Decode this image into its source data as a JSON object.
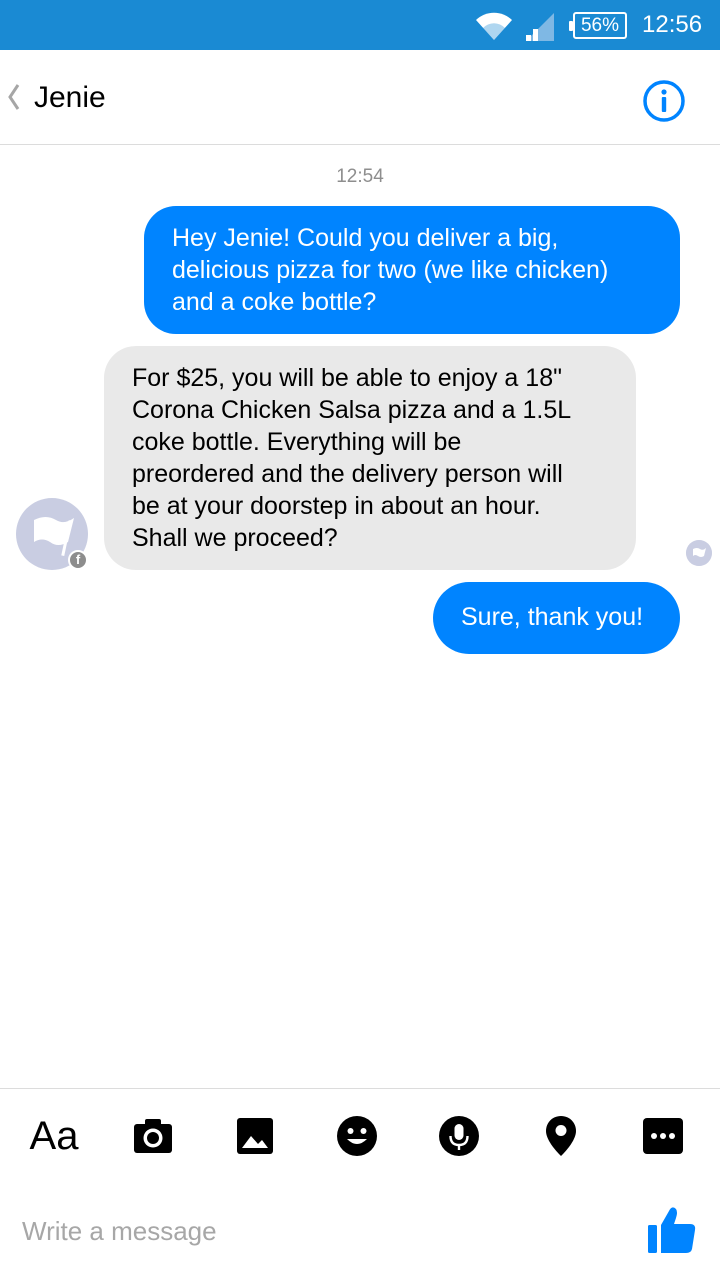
{
  "status_bar": {
    "battery": "56%",
    "time": "12:56"
  },
  "header": {
    "title": "Jenie"
  },
  "conversation": {
    "timestamp": "12:54",
    "messages": [
      {
        "sender": "me",
        "lines": [
          "Hey Jenie! Could you deliver a big,",
          "delicious pizza for two (we like chicken)",
          "and a coke bottle?"
        ]
      },
      {
        "sender": "Jenie",
        "lines": [
          "For $25, you will be able to enjoy a 18\"",
          "Corona Chicken Salsa pizza and a 1.5L",
          "coke bottle. Everything will be",
          "preordered and the delivery person will",
          "be at your doorstep in about an hour.",
          "Shall we proceed?"
        ]
      },
      {
        "sender": "me",
        "lines": [
          "Sure, thank you!"
        ]
      }
    ]
  },
  "toolbar": {
    "text_button": "Aa",
    "icons": [
      "camera-icon",
      "gallery-icon",
      "emoji-icon",
      "microphone-icon",
      "location-icon",
      "more-icon"
    ]
  },
  "composer": {
    "placeholder": "Write a message"
  },
  "colors": {
    "status_bar": "#1a8ad3",
    "accent": "#0084ff",
    "incoming_bubble": "#e9e9e9"
  }
}
